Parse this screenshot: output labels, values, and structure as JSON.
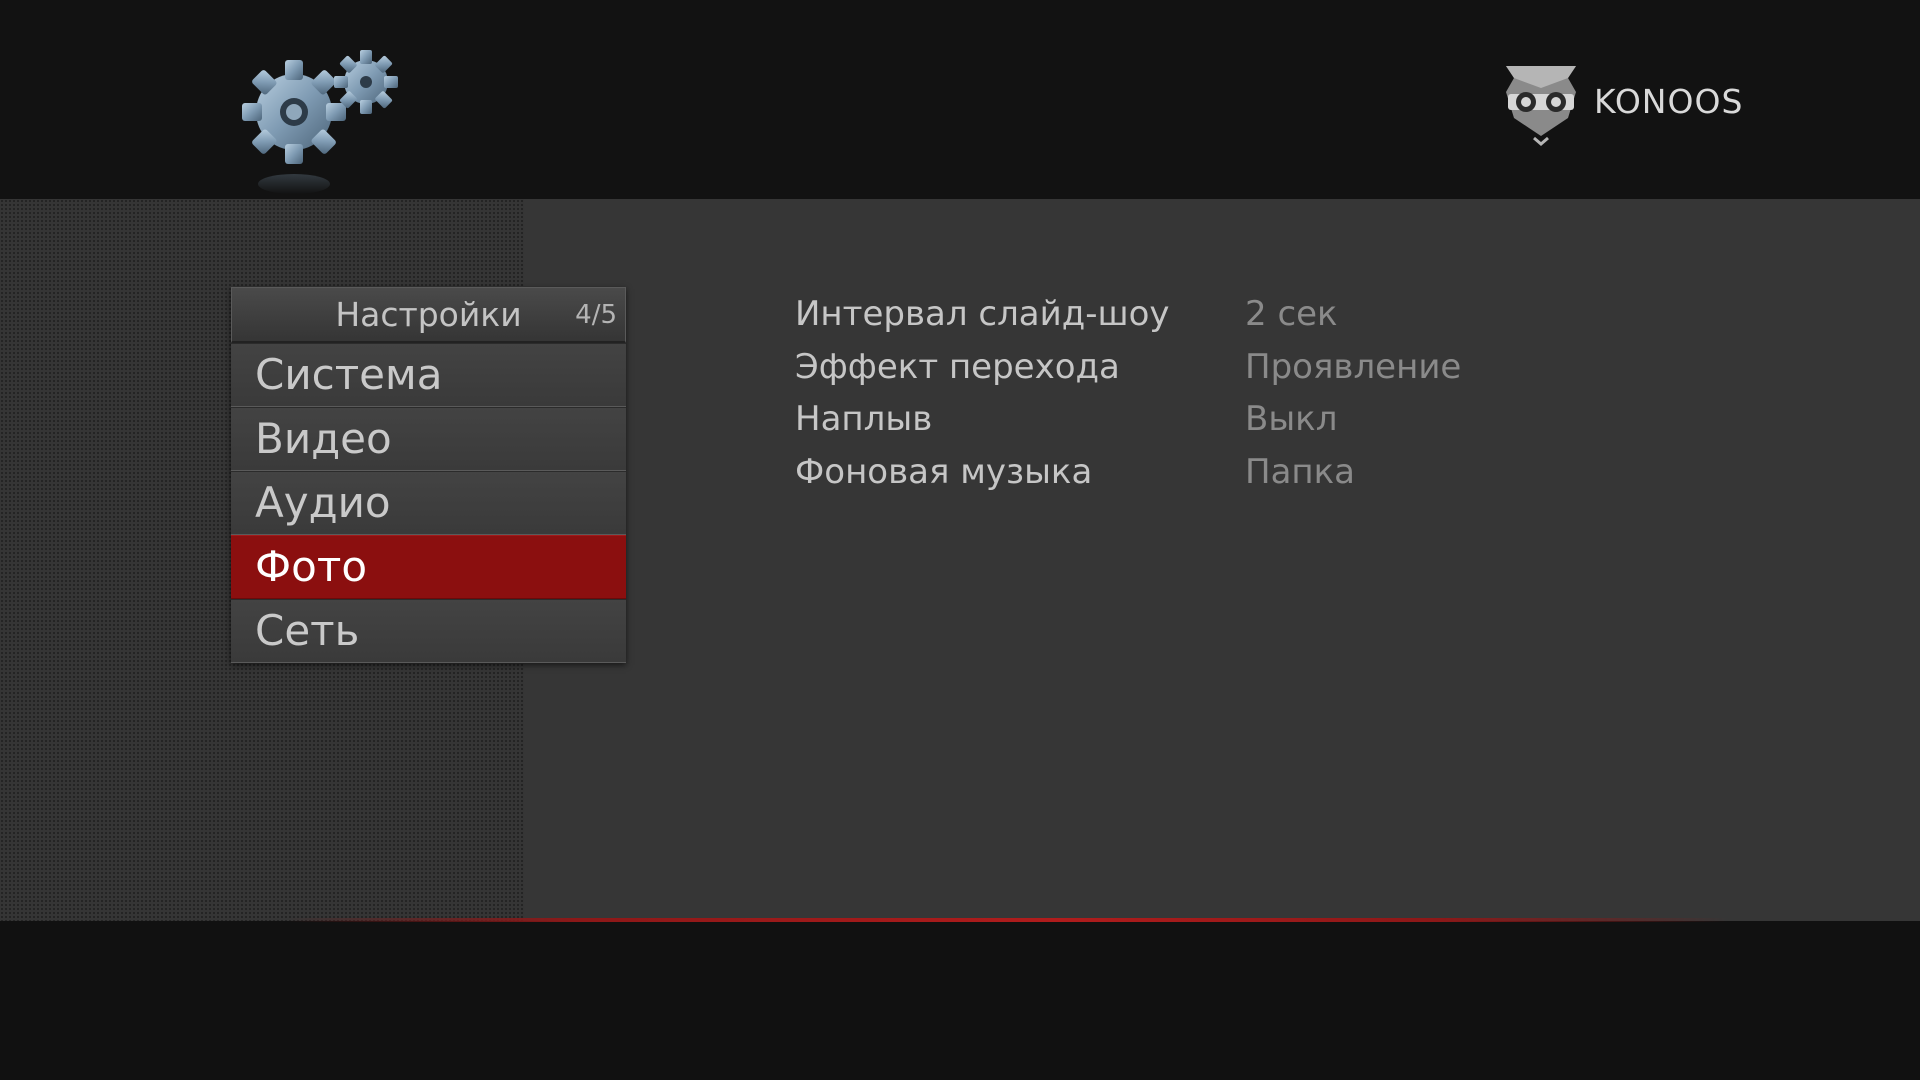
{
  "header": {
    "settings_icon": "gears-icon",
    "brand": {
      "name": "KONOOS",
      "logo_icon": "owl-logo-icon"
    }
  },
  "menu": {
    "title": "Настройки",
    "counter": "4/5",
    "items": [
      {
        "label": "Система",
        "selected": false
      },
      {
        "label": "Видео",
        "selected": false
      },
      {
        "label": "Аудио",
        "selected": false
      },
      {
        "label": "Фото",
        "selected": true
      },
      {
        "label": "Сеть",
        "selected": false
      }
    ]
  },
  "settings": [
    {
      "name": "Интервал слайд-шоу",
      "value": "2 сек"
    },
    {
      "name": "Эффект перехода",
      "value": "Проявление"
    },
    {
      "name": "Наплыв",
      "value": "Выкл"
    },
    {
      "name": "Фоновая музыка",
      "value": "Папка"
    }
  ],
  "colors": {
    "accent": "#8b0f0f",
    "background": "#363636",
    "bar": "#121212"
  }
}
